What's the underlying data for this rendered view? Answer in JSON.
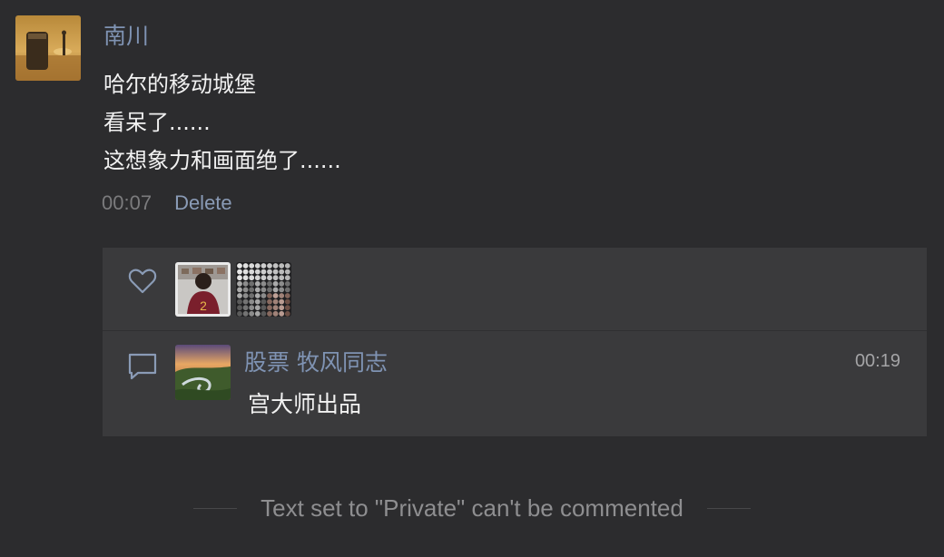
{
  "post": {
    "author": "南川",
    "lines": [
      "哈尔的移动城堡",
      "看呆了......",
      "这想象力和画面绝了......"
    ],
    "time": "00:07",
    "delete_label": "Delete"
  },
  "comment": {
    "author": "股票 牧风同志",
    "time": "00:19",
    "text": "宫大师出品"
  },
  "footer": {
    "notice": "Text set to \"Private\" can't be commented"
  },
  "icons": {
    "like": "heart-icon",
    "comment": "comment-icon"
  },
  "colors": {
    "background": "#2c2c2e",
    "panel": "#3a3a3c",
    "name_link": "#7f93b3",
    "text": "#f1f1f1",
    "muted": "#7b7b7d"
  }
}
